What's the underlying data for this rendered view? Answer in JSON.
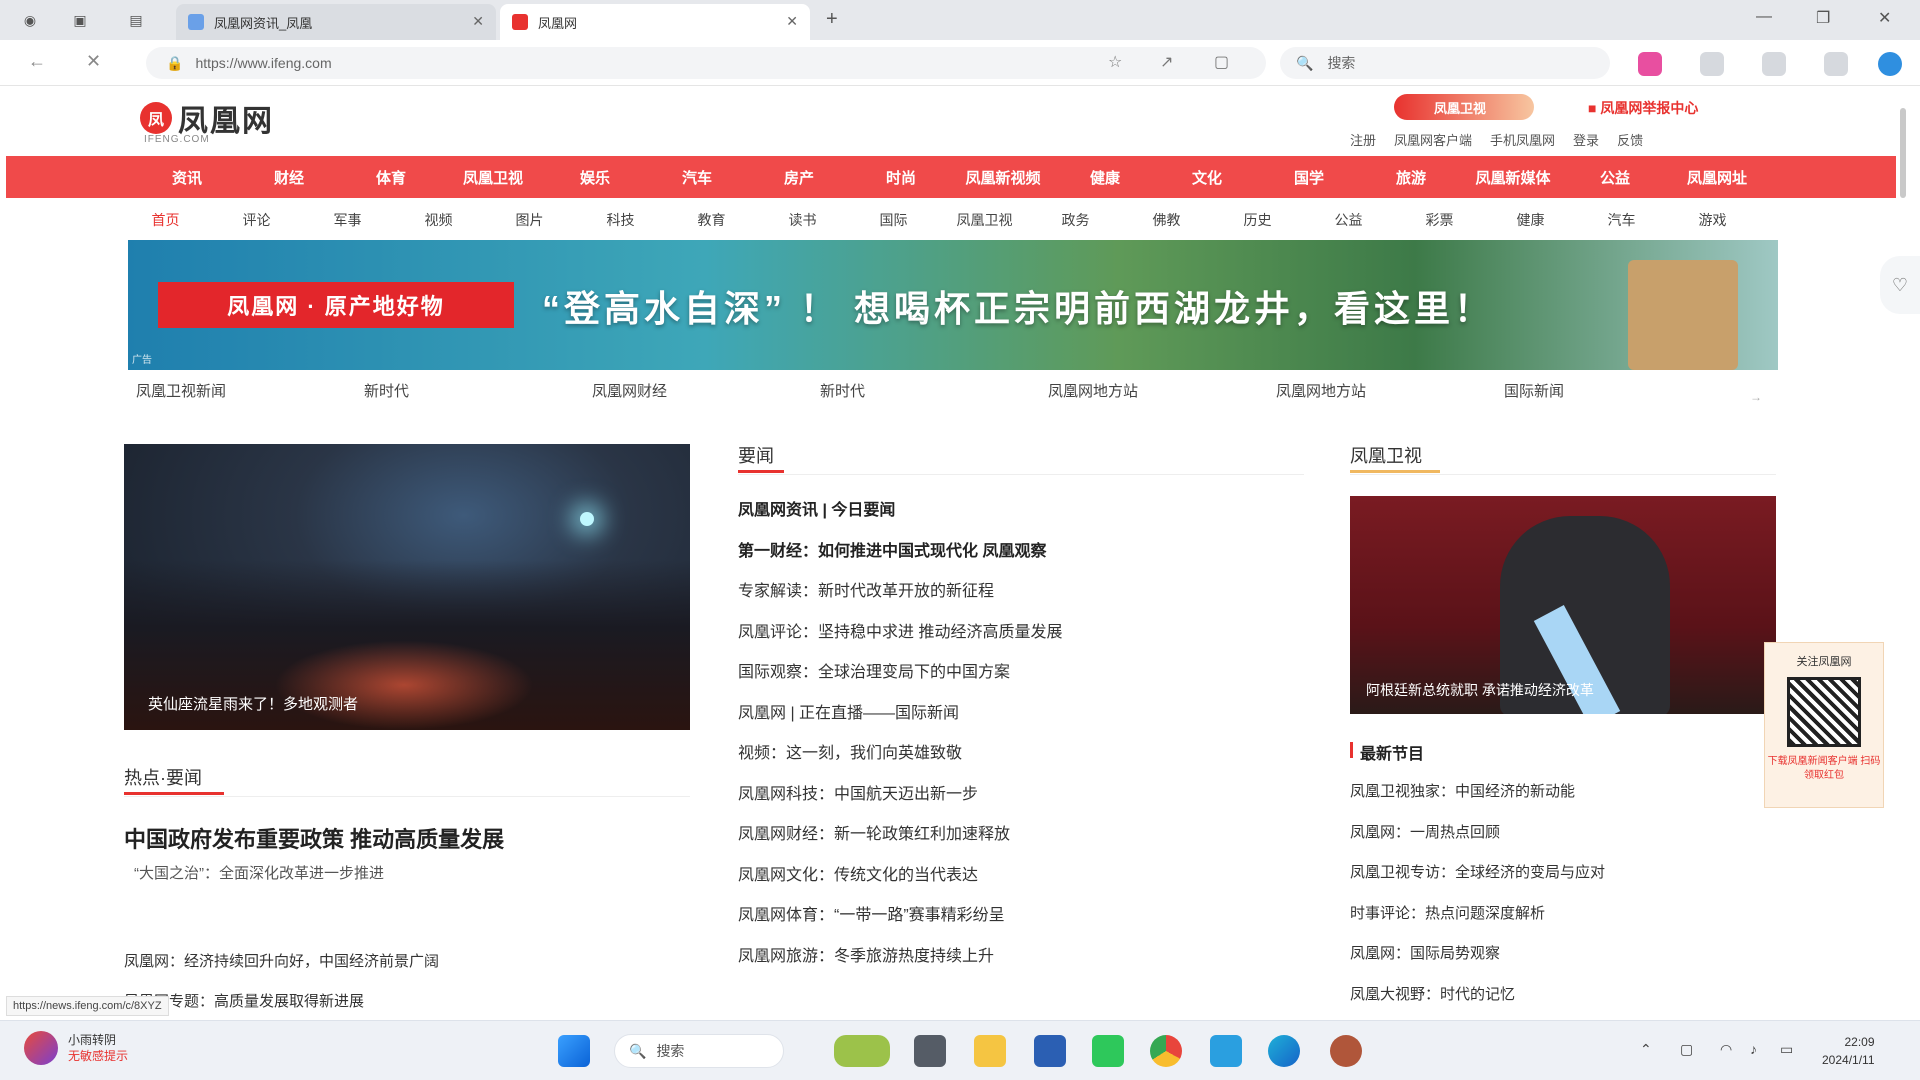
{
  "browser": {
    "tabs": [
      {
        "title": "凤凰网资讯_凤凰",
        "active": false
      },
      {
        "title": "凤凰网",
        "active": true
      }
    ],
    "url": "https://www.ifeng.com",
    "search_placeholder": "搜索",
    "accent_color": "#f04a4a"
  },
  "site": {
    "logo_text": "凤凰网",
    "logo_mark": "凤",
    "logo_sub": "IFENG.COM",
    "promo_label": "凤凰卫视",
    "report_label": "■ 凤凰网举报中心",
    "header_links": [
      "注册",
      "凤凰网客户端",
      "手机凤凰网",
      "登录",
      "反馈"
    ]
  },
  "main_nav": [
    "资讯",
    "财经",
    "体育",
    "凤凰卫视",
    "娱乐",
    "汽车",
    "房产",
    "时尚",
    "凤凰新视频",
    "健康",
    "文化",
    "国学",
    "旅游",
    "凤凰新媒体",
    "公益",
    "凤凰网址"
  ],
  "sub_nav": [
    "首页",
    "评论",
    "军事",
    "视频",
    "图片",
    "科技",
    "教育",
    "读书",
    "国际",
    "凤凰卫视",
    "政务",
    "佛教",
    "历史",
    "公益",
    "彩票",
    "健康",
    "汽车",
    "游戏"
  ],
  "banner": {
    "tag": "凤凰网 · 原产地好物",
    "headline": "“登高水自深” ！ 想喝杯正宗明前西湖龙井，看这里！",
    "ad_label": "广告"
  },
  "quick_links": [
    "凤凰卫视新闻",
    "新时代",
    "凤凰网财经",
    "新时代",
    "凤凰网地方站",
    "凤凰网地方站",
    "国际新闻"
  ],
  "hero": {
    "caption": "英仙座流星雨来了！多地观测者"
  },
  "left_section": {
    "title": "热点·要闻",
    "lead_headline": "中国政府发布重要政策 推动高质量发展",
    "lead_sub": "“大国之治”：全面深化改革进一步推进",
    "items": [
      "凤凰网：经济持续回升向好，中国经济前景广阔",
      "凤凰网专题：高质量发展取得新进展"
    ]
  },
  "mid_section": {
    "title": "要闻",
    "items": [
      {
        "text": "凤凰网资讯 | 今日要闻",
        "bold": true
      },
      {
        "text": "第一财经：如何推进中国式现代化 凤凰观察",
        "bold": true
      },
      {
        "text": "专家解读：新时代改革开放的新征程",
        "bold": false
      },
      {
        "text": "凤凰评论：坚持稳中求进 推动经济高质量发展",
        "bold": false
      },
      {
        "text": "国际观察：全球治理变局下的中国方案",
        "bold": false
      },
      {
        "text": "凤凰网 | 正在直播——国际新闻",
        "bold": false
      },
      {
        "text": "视频：这一刻，我们向英雄致敬",
        "bold": false
      },
      {
        "text": "凤凰网科技：中国航天迈出新一步",
        "bold": false
      },
      {
        "text": "凤凰网财经：新一轮政策红利加速释放",
        "bold": false
      },
      {
        "text": "凤凰网文化：传统文化的当代表达",
        "bold": false
      },
      {
        "text": "凤凰网体育：“一带一路”赛事精彩纷呈",
        "bold": false
      },
      {
        "text": "凤凰网旅游：冬季旅游热度持续上升",
        "bold": false
      }
    ]
  },
  "right_section": {
    "title": "凤凰卫视",
    "photo_caption": "阿根廷新总统就职 承诺推动经济改革",
    "sub_title": "最新节目",
    "items": [
      "凤凰卫视独家：中国经济的新动能",
      "凤凰网：一周热点回顾",
      "凤凰卫视专访：全球经济的变局与应对",
      "时事评论：热点问题深度解析",
      "凤凰网：国际局势观察",
      "凤凰大视野：时代的记忆"
    ]
  },
  "qr": {
    "title": "关注凤凰网",
    "bottom": "下载凤凰新闻客户端 扫码领取红包"
  },
  "status_url": "https://news.ifeng.com/c/8XYZ",
  "taskbar": {
    "weather_line1": "小雨转阴",
    "weather_line2": "无敏感提示",
    "search_label": "搜索",
    "time": "22:09",
    "date": "2024/1/11"
  }
}
